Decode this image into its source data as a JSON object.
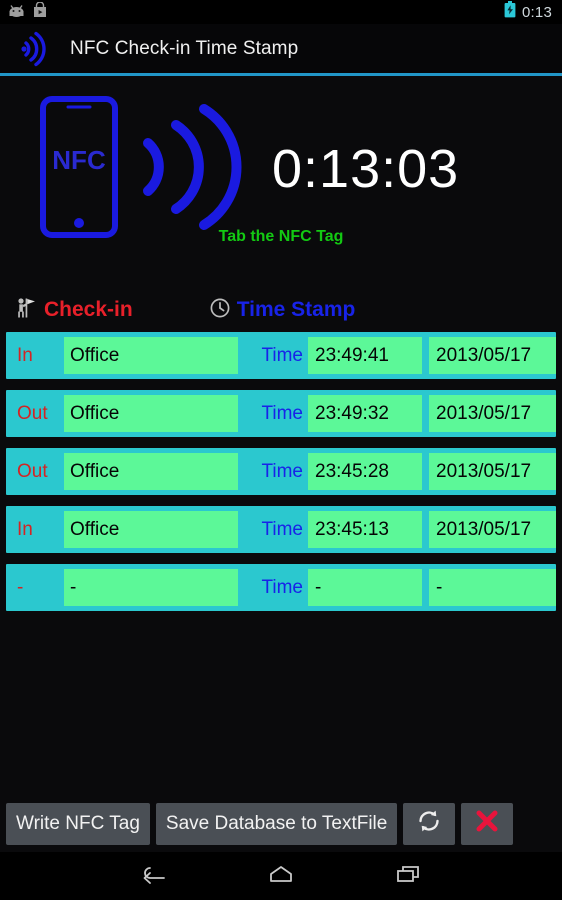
{
  "status_bar": {
    "notification_icons": [
      "android-robot-icon",
      "play-store-icon"
    ],
    "battery_icon": "battery-charging-icon",
    "clock": "0:13"
  },
  "action_bar": {
    "app_icon": "nfc-wave-icon",
    "title": "NFC Check-in Time Stamp"
  },
  "hero": {
    "phone_icon": "nfc-phone-icon",
    "phone_label": "NFC",
    "wave_icon": "nfc-signal-waves-icon",
    "timer": "0:13:03",
    "hint": "Tab the NFC Tag"
  },
  "column_headers": {
    "checkin_icon": "person-flag-icon",
    "checkin_label": "Check-in",
    "timestamp_icon": "clock-icon",
    "timestamp_label": "Time Stamp"
  },
  "table": {
    "time_label": "Time",
    "rows": [
      {
        "direction": "In",
        "place": "Office",
        "time_label": "Time",
        "time": "23:49:41",
        "date": "2013/05/17"
      },
      {
        "direction": "Out",
        "place": "Office",
        "time_label": "Time",
        "time": "23:49:32",
        "date": "2013/05/17"
      },
      {
        "direction": "Out",
        "place": "Office",
        "time_label": "Time",
        "time": "23:45:28",
        "date": "2013/05/17"
      },
      {
        "direction": "In",
        "place": "Office",
        "time_label": "Time",
        "time": "23:45:13",
        "date": "2013/05/17"
      },
      {
        "direction": "-",
        "place": "-",
        "time_label": "Time",
        "time": "-",
        "date": "-"
      }
    ]
  },
  "buttons": {
    "write_tag": "Write NFC Tag",
    "save_database": "Save Database to TextFile",
    "refresh_icon": "refresh-icon",
    "delete_icon": "red-x-delete-icon"
  },
  "nav_bar": {
    "back_icon": "back-arrow-icon",
    "home_icon": "home-icon",
    "recents_icon": "recent-apps-icon"
  },
  "colors": {
    "row_background": "#2bc8cf",
    "field_background": "#5cf898",
    "direction_text": "#d42424",
    "time_label_text": "#1823e8",
    "hint_text": "#13c913",
    "accent_line": "#2196c8",
    "nfc_blue": "#1a1ae0"
  }
}
